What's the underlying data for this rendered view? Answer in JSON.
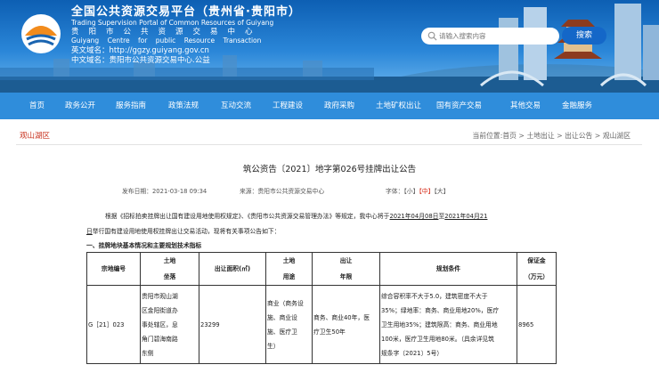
{
  "header": {
    "title_cn": "全国公共资源交易平台（贵州省·贵阳市）",
    "title_en": "Trading Supervision Portal of Common Resources of Guiyang",
    "org_cn": "贵阳市公共资源交易中心",
    "org_en": "Guiyang Centre for public Resource Transaction",
    "url_en": "英文域名：http://ggzy.guiyang.gov.cn",
    "url_cn": "中文域名：贵阳市公共资源交易中心.公益",
    "search_placeholder": "请输入搜索内容",
    "search_button": "搜索"
  },
  "nav": [
    "首页",
    "政务公开",
    "服务指南",
    "政策法规",
    "互动交流",
    "工程建设",
    "政府采购",
    "土地矿权出让",
    "国有资产交易",
    "其他交易",
    "金融服务"
  ],
  "breadcrumb": {
    "section": "观山湖区",
    "path": "当前位置:首页 > 土地出让 > 出让公告 > 观山湖区"
  },
  "article": {
    "title": "筑公资告〔2021〕地字第026号挂牌出让公告",
    "published": "发布日期：2021-03-18 09:34",
    "source": "来源：贵阳市公共资源交易中心",
    "font_label": "字体：",
    "font_small": "【小】",
    "font_medium": "【中】",
    "font_large": "【大】",
    "para1_a": "根据《招标拍卖挂牌出让国有建设用地使用权规定》、《贵阳市公共资源交易管理办法》等规定，我中心将于",
    "para1_date1": "2021年04月08日",
    "para1_mid": "至",
    "para1_date2": "2021年04月21",
    "para2_date": "日",
    "para2_rest": "举行国有建设用地使用权挂牌出让交易活动，现将有关事项公告如下：",
    "heading1": "一、挂牌地块基本情况和主要规划技术指标"
  },
  "table": {
    "headers": [
      "宗地编号",
      "土地\n坐落",
      "出让面积(㎡)",
      "土地\n用途",
      "出让\n年限",
      "规划条件",
      "保证金\n（万元）"
    ],
    "rows": [
      [
        "G［21］023",
        "贵阳市观山湖\n区金阳街道办\n事处辖区，息\n角门碧海南路\n东侧",
        "23299",
        "商业（商务设\n施、商业设\n施、医疗卫\n生）",
        "商务、商业40年，医\n疗卫生50年",
        "综合容积率不大于5.0，建筑密度不大于\n35%；绿地率：商务、商业用地20%，医疗\n卫生用地35%；建筑限高：商务、商业用地\n100米，医疗卫生用地80米。（具余详见筑\n规条字〔2021〕5号）",
        "8965"
      ]
    ]
  },
  "colors": {
    "nav_bg": "#2f8ddb",
    "accent_red": "#c8321e",
    "search_button": "#1467c8"
  }
}
